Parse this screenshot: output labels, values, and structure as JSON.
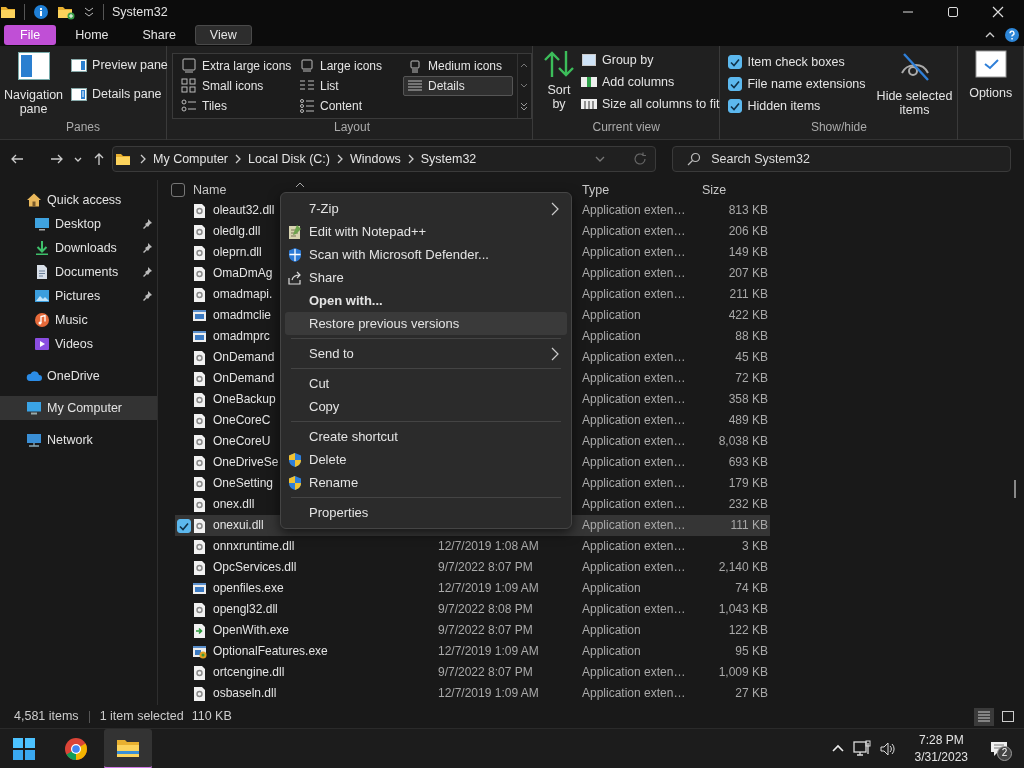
{
  "window": {
    "title": "System32"
  },
  "ribbon_tabs": [
    {
      "label": "File",
      "kind": "file",
      "selected": false
    },
    {
      "label": "Home",
      "kind": "tab",
      "selected": false
    },
    {
      "label": "Share",
      "kind": "tab",
      "selected": false
    },
    {
      "label": "View",
      "kind": "tab",
      "selected": true
    }
  ],
  "ribbon": {
    "panes": {
      "label": "Panes",
      "navigation_pane": "Navigation pane",
      "preview_pane": "Preview pane",
      "details_pane": "Details pane"
    },
    "layout": {
      "label": "Layout",
      "options": [
        {
          "label": "Extra large icons",
          "selected": false
        },
        {
          "label": "Large icons",
          "selected": false
        },
        {
          "label": "Medium icons",
          "selected": false
        },
        {
          "label": "Small icons",
          "selected": false
        },
        {
          "label": "List",
          "selected": false
        },
        {
          "label": "Details",
          "selected": true
        },
        {
          "label": "Tiles",
          "selected": false
        },
        {
          "label": "Content",
          "selected": false
        }
      ]
    },
    "current_view": {
      "label": "Current view",
      "sort": "Sort by",
      "group_by": "Group by",
      "add_columns": "Add columns",
      "size_columns": "Size all columns to fit"
    },
    "show_hide": {
      "label": "Show/hide",
      "checkboxes": [
        {
          "label": "Item check boxes",
          "checked": true
        },
        {
          "label": "File name extensions",
          "checked": true
        },
        {
          "label": "Hidden items",
          "checked": true
        }
      ],
      "hide_selected": "Hide selected items"
    },
    "options": "Options"
  },
  "address": {
    "crumbs": [
      "My Computer",
      "Local Disk (C:)",
      "Windows",
      "System32"
    ],
    "search_placeholder": "Search System32"
  },
  "sidebar": [
    {
      "label": "Quick access",
      "kind": "home",
      "selected": false,
      "children": [
        {
          "label": "Desktop",
          "kind": "desktop",
          "pinned": true,
          "selected": false
        },
        {
          "label": "Downloads",
          "kind": "downloads",
          "pinned": true,
          "selected": false
        },
        {
          "label": "Documents",
          "kind": "documents",
          "pinned": true,
          "selected": false
        },
        {
          "label": "Pictures",
          "kind": "pictures",
          "pinned": true,
          "selected": false
        },
        {
          "label": "Music",
          "kind": "music",
          "pinned": false,
          "selected": false
        },
        {
          "label": "Videos",
          "kind": "videos",
          "pinned": false,
          "selected": false
        }
      ]
    },
    {
      "label": "OneDrive",
      "kind": "cloud",
      "selected": false
    },
    {
      "label": "My Computer",
      "kind": "computer",
      "selected": true
    },
    {
      "label": "Network",
      "kind": "network",
      "selected": false
    }
  ],
  "columns": [
    "Name",
    "Type",
    "Size"
  ],
  "select_all": false,
  "rows": [
    {
      "name": "oleaut32.dll",
      "kind": "dll",
      "type": "Application exten…",
      "size": "813 KB",
      "selected": false
    },
    {
      "name": "oledlg.dll",
      "kind": "dll",
      "type": "Application exten…",
      "size": "206 KB",
      "selected": false
    },
    {
      "name": "oleprn.dll",
      "kind": "dll",
      "type": "Application exten…",
      "size": "149 KB",
      "selected": false
    },
    {
      "name": "OmaDmAg",
      "kind": "dll",
      "type": "Application exten…",
      "size": "207 KB",
      "selected": false
    },
    {
      "name": "omadmapi.",
      "kind": "dll",
      "type": "Application exten…",
      "size": "211 KB",
      "selected": false
    },
    {
      "name": "omadmclie",
      "kind": "exe",
      "type": "Application",
      "size": "422 KB",
      "selected": false
    },
    {
      "name": "omadmprc",
      "kind": "exe",
      "type": "Application",
      "size": "88 KB",
      "selected": false
    },
    {
      "name": "OnDemand",
      "kind": "dll",
      "type": "Application exten…",
      "size": "45 KB",
      "selected": false
    },
    {
      "name": "OnDemand",
      "kind": "dll",
      "type": "Application exten…",
      "size": "72 KB",
      "selected": false
    },
    {
      "name": "OneBackup",
      "kind": "dll",
      "type": "Application exten…",
      "size": "358 KB",
      "selected": false
    },
    {
      "name": "OneCoreC",
      "kind": "dll",
      "type": "Application exten…",
      "size": "489 KB",
      "selected": false
    },
    {
      "name": "OneCoreU",
      "kind": "dll",
      "type": "Application exten…",
      "size": "8,038 KB",
      "selected": false
    },
    {
      "name": "OneDriveSe",
      "kind": "dll",
      "type": "Application exten…",
      "size": "693 KB",
      "selected": false
    },
    {
      "name": "OneSetting",
      "kind": "dll",
      "type": "Application exten…",
      "size": "179 KB",
      "selected": false
    },
    {
      "name": "onex.dll",
      "kind": "dll",
      "type": "Application exten…",
      "size": "232 KB",
      "selected": false
    },
    {
      "name": "onexui.dll",
      "kind": "dll",
      "type": "Application exten…",
      "size": "111 KB",
      "selected": true
    },
    {
      "name": "onnxruntime.dll",
      "kind": "dll",
      "date": "12/7/2019 1:08 AM",
      "type": "Application exten…",
      "size": "3 KB",
      "selected": false
    },
    {
      "name": "OpcServices.dll",
      "kind": "dll",
      "date": "9/7/2022 8:07 PM",
      "type": "Application exten…",
      "size": "2,140 KB",
      "selected": false
    },
    {
      "name": "openfiles.exe",
      "kind": "exe",
      "date": "12/7/2019 1:09 AM",
      "type": "Application",
      "size": "74 KB",
      "selected": false
    },
    {
      "name": "opengl32.dll",
      "kind": "dll",
      "date": "9/7/2022 8:08 PM",
      "type": "Application exten…",
      "size": "1,043 KB",
      "selected": false
    },
    {
      "name": "OpenWith.exe",
      "kind": "openwith",
      "date": "9/7/2022 8:07 PM",
      "type": "Application",
      "size": "122 KB",
      "selected": false
    },
    {
      "name": "OptionalFeatures.exe",
      "kind": "features",
      "date": "12/7/2019 1:09 AM",
      "type": "Application",
      "size": "95 KB",
      "selected": false
    },
    {
      "name": "ortcengine.dll",
      "kind": "dll",
      "date": "9/7/2022 8:07 PM",
      "type": "Application exten…",
      "size": "1,009 KB",
      "selected": false
    },
    {
      "name": "osbaseln.dll",
      "kind": "dll",
      "date": "12/7/2019 1:09 AM",
      "type": "Application exten…",
      "size": "27 KB",
      "selected": false
    }
  ],
  "context_menu": [
    {
      "kind": "plain",
      "label": "7-Zip",
      "submenu": true,
      "default": false,
      "highlighted": false
    },
    {
      "kind": "notepad",
      "label": "Edit with Notepad++",
      "submenu": false,
      "default": false,
      "highlighted": false
    },
    {
      "kind": "defender",
      "label": "Scan with Microsoft Defender...",
      "submenu": false,
      "default": false,
      "highlighted": false
    },
    {
      "kind": "share",
      "label": "Share",
      "submenu": false,
      "default": false,
      "highlighted": false
    },
    {
      "kind": "plain",
      "label": "Open with...",
      "submenu": false,
      "default": true,
      "highlighted": false
    },
    {
      "kind": "plain",
      "label": "Restore previous versions",
      "submenu": false,
      "default": false,
      "highlighted": true
    },
    {
      "kind": "separator"
    },
    {
      "kind": "plain",
      "label": "Send to",
      "submenu": true,
      "default": false,
      "highlighted": false
    },
    {
      "kind": "separator"
    },
    {
      "kind": "plain",
      "label": "Cut",
      "submenu": false,
      "default": false,
      "highlighted": false
    },
    {
      "kind": "plain",
      "label": "Copy",
      "submenu": false,
      "default": false,
      "highlighted": false
    },
    {
      "kind": "separator"
    },
    {
      "kind": "plain",
      "label": "Create shortcut",
      "submenu": false,
      "default": false,
      "highlighted": false
    },
    {
      "kind": "uac",
      "label": "Delete",
      "submenu": false,
      "default": false,
      "highlighted": false
    },
    {
      "kind": "uac",
      "label": "Rename",
      "submenu": false,
      "default": false,
      "highlighted": false
    },
    {
      "kind": "separator"
    },
    {
      "kind": "plain",
      "label": "Properties",
      "submenu": false,
      "default": false,
      "highlighted": false
    }
  ],
  "status_bar": {
    "items": "4,581 items",
    "selection": "1 item selected",
    "size": "110 KB",
    "views": [
      {
        "kind": "details",
        "selected": true
      },
      {
        "kind": "tiles",
        "selected": false
      }
    ]
  },
  "taskbar": {
    "apps": [
      {
        "kind": "start",
        "selected": false
      },
      {
        "kind": "chrome",
        "selected": false
      },
      {
        "kind": "explorer",
        "selected": true
      }
    ],
    "time": "7:28 PM",
    "date": "3/31/2023",
    "notifications": "2"
  }
}
